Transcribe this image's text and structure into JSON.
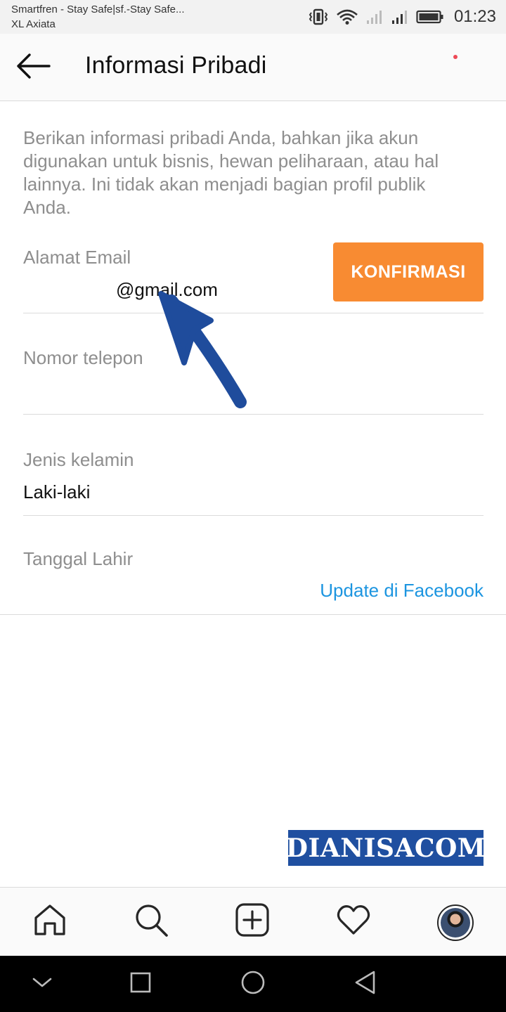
{
  "status_bar": {
    "carrier_line1": "Smartfren - Stay Safe|sf.-Stay Safe...",
    "carrier_line2": "XL Axiata",
    "time": "01:23",
    "icons": [
      "vibrate-icon",
      "wifi-icon",
      "signal-icon",
      "signal-icon",
      "battery-icon"
    ]
  },
  "header": {
    "back_icon": "arrow-left-icon",
    "title": "Informasi Pribadi"
  },
  "intro_text": "Berikan informasi pribadi Anda, bahkan jika akun digunakan untuk bisnis, hewan peliharaan, atau hal lainnya. Ini tidak akan menjadi bagian profil publik Anda.",
  "fields": {
    "email": {
      "label": "Alamat Email",
      "value": "@gmail.com",
      "confirm_label": "KONFIRMASI"
    },
    "phone": {
      "label": "Nomor telepon",
      "value": ""
    },
    "gender": {
      "label": "Jenis kelamin",
      "value": "Laki-laki"
    },
    "birthdate": {
      "label": "Tanggal Lahir",
      "link": "Update di Facebook"
    }
  },
  "watermark": "DIANISACOM",
  "tab_bar": {
    "items": [
      "home-icon",
      "search-icon",
      "add-post-icon",
      "heart-icon",
      "profile-avatar"
    ]
  },
  "nav_bar": {
    "items": [
      "chevron-down-icon",
      "recent-apps-icon",
      "home-circle-icon",
      "back-triangle-icon"
    ]
  },
  "colors": {
    "accent_button": "#f88b32",
    "link": "#1c95e0",
    "annotation_arrow": "#1f4c9c",
    "watermark_bg": "#1f4fa0",
    "notification_dot": "#ed4956"
  }
}
